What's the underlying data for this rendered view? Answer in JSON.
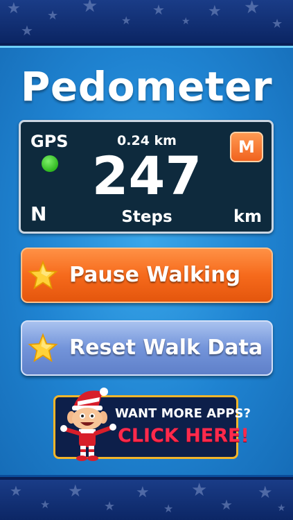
{
  "app": {
    "title": "Pedometer"
  },
  "display": {
    "gps_label": "GPS",
    "gps_status_color": "#3ad12a",
    "distance": "0.24 km",
    "steps": "247",
    "steps_label": "Steps",
    "compass": "N",
    "unit": "km",
    "mode_button": "M"
  },
  "buttons": {
    "pause_walking": "Pause Walking",
    "reset_walk_data": "Reset Walk Data"
  },
  "ad": {
    "line1": "WANT MORE APPS?",
    "line2": "CLICK HERE!",
    "mascot_icon": "elf-mascot"
  },
  "colors": {
    "accent_orange": "#f66a1c",
    "accent_blue": "#7394da",
    "panel_bg": "#0e2a3d",
    "main_blue": "#1f83d1"
  }
}
